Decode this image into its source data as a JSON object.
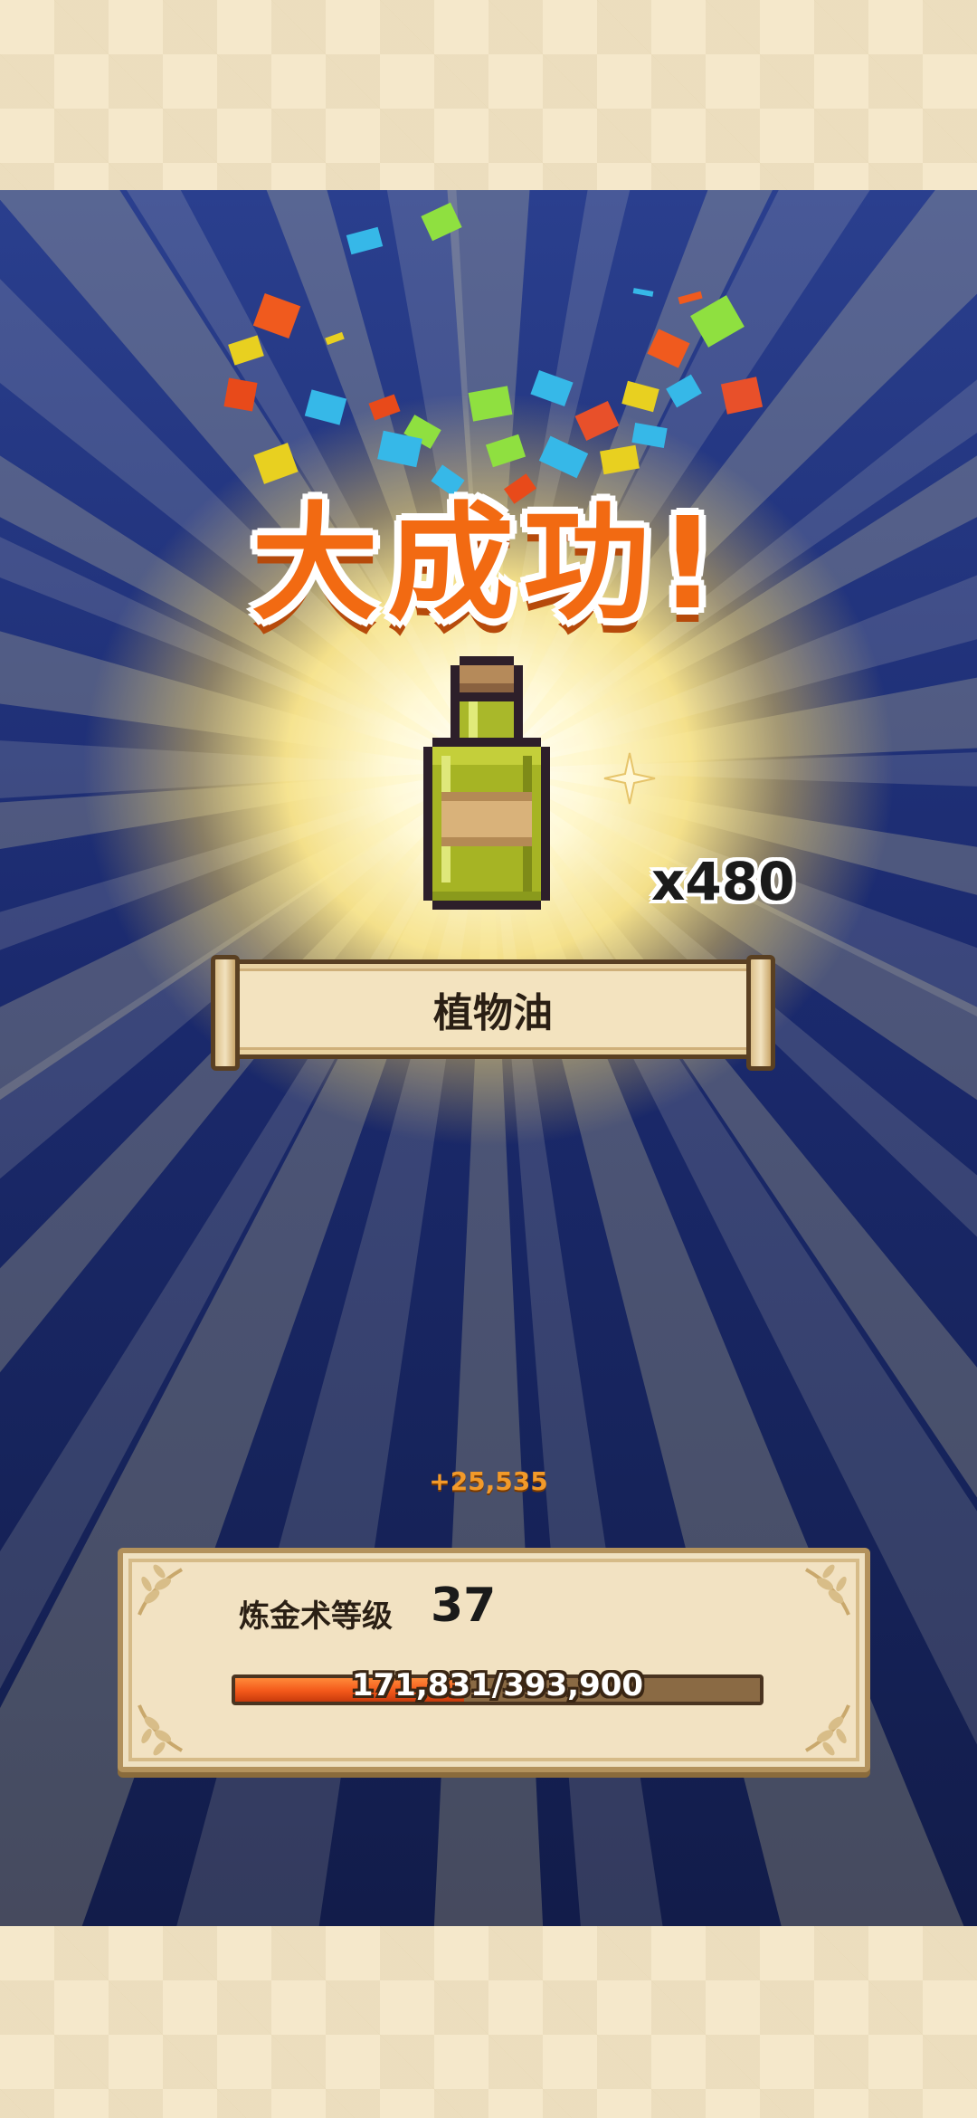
{
  "result": {
    "title": "大成功!",
    "quantity": "x480",
    "item_name": "植物油",
    "item_icon": "olive-oil-bottle-icon"
  },
  "experience": {
    "gain": "+25,535",
    "skill_label": "炼金术等级",
    "level": "37",
    "progress_text": "171,831/393,900",
    "current": 171831,
    "required": 393900
  },
  "colors": {
    "title": "#f26a12",
    "xp_gain": "#f29a2a",
    "bar_fill": "#f3581a",
    "panel": "#f2e2c2",
    "background": "#1b2a6e"
  }
}
